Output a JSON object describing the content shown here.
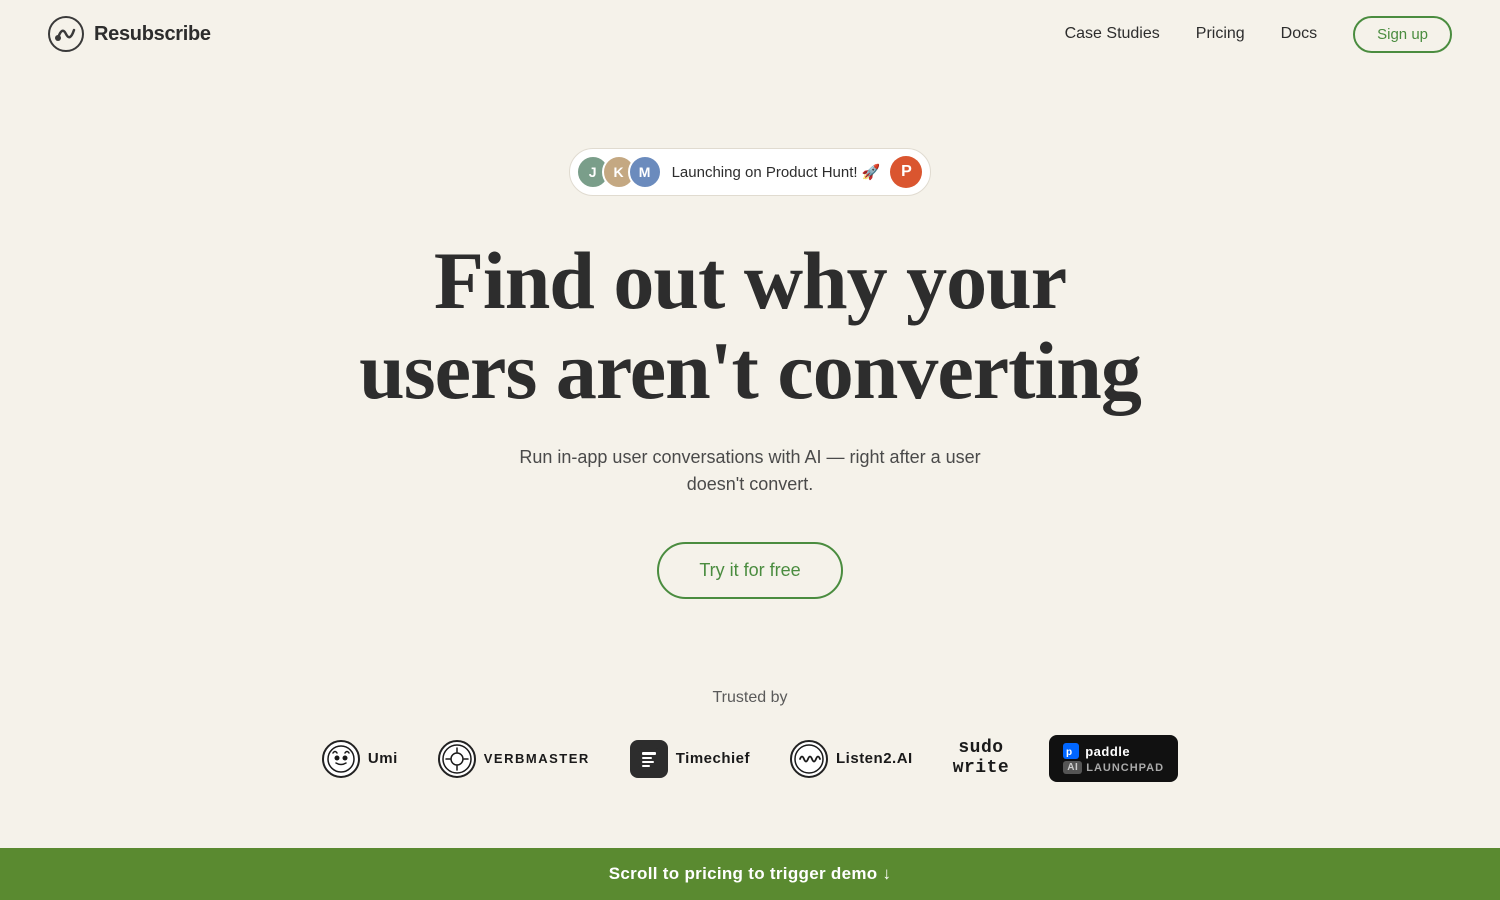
{
  "nav": {
    "logo_text": "Resubscribe",
    "links": [
      {
        "label": "Case Studies",
        "name": "case-studies"
      },
      {
        "label": "Pricing",
        "name": "pricing"
      },
      {
        "label": "Docs",
        "name": "docs"
      }
    ],
    "signup_label": "Sign up"
  },
  "hero": {
    "badge_label": "Launching on Product Hunt! 🚀",
    "badge_avatars": [
      {
        "initials": "J"
      },
      {
        "initials": "K"
      },
      {
        "initials": "M"
      }
    ],
    "heading_line1": "Find out why your",
    "heading_line2": "users aren't converting",
    "subheading": "Run in-app user conversations with AI — right after a user doesn't convert.",
    "cta_label": "Try it for free"
  },
  "trusted": {
    "label": "Trusted by",
    "logos": [
      {
        "name": "Umi",
        "icon": "🐧",
        "style": "umi"
      },
      {
        "name": "VERBMASTER",
        "icon": "⚙",
        "style": "verbmaster"
      },
      {
        "name": "Timechief",
        "icon": "📋",
        "style": "timechief"
      },
      {
        "name": "Listen2.AI",
        "icon": "〰",
        "style": "listen2ai"
      },
      {
        "name": "sudo\nwrite",
        "icon": "",
        "style": "sudowrite"
      },
      {
        "name": "paddle AI Launchpad",
        "icon": "",
        "style": "paddle"
      }
    ]
  },
  "bottom_bar": {
    "text": "Scroll to pricing to trigger demo ↓"
  }
}
